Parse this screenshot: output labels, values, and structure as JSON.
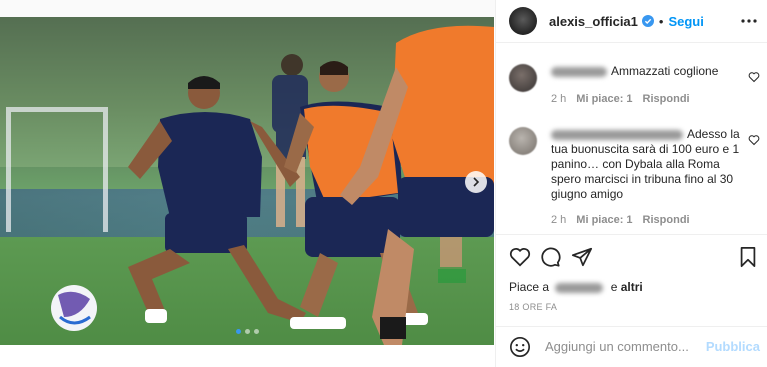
{
  "post": {
    "username": "alexis_officia1",
    "separator": "•",
    "follow_label": "Segui"
  },
  "comments": [
    {
      "text": "Ammazzati coglione",
      "time": "2 h",
      "likes": "Mi piace: 1",
      "reply": "Rispondi"
    },
    {
      "text": "Adesso la tua buonuscita sarà di 100 euro e 1 panino… con Dybala alla Roma spero marcisci in tribuna fino al 30 giugno amigo",
      "time": "2 h",
      "likes": "Mi piace: 1",
      "reply": "Rispondi"
    }
  ],
  "likes_line": {
    "prefix": "Piace a",
    "connector": "e",
    "others": "altri"
  },
  "time_ago": "18 ORE FA",
  "add_comment": {
    "placeholder": "Aggiungi un commento...",
    "publish_label": "Pubblica"
  },
  "carousel": {
    "slide_count": 3,
    "active_index": 0
  },
  "colors": {
    "accent": "#0095f6",
    "publish_disabled": "#b3dbff",
    "verified": "#3897f0",
    "meta_text": "#8e8e8e"
  },
  "icons": {
    "header_more": "more-dots-icon",
    "comment_like": "heart-outline-icon",
    "like": "heart-icon",
    "comment": "comment-bubble-icon",
    "share": "paper-plane-icon",
    "save": "bookmark-icon",
    "emoji": "smiley-icon",
    "next": "chevron-right-icon"
  }
}
